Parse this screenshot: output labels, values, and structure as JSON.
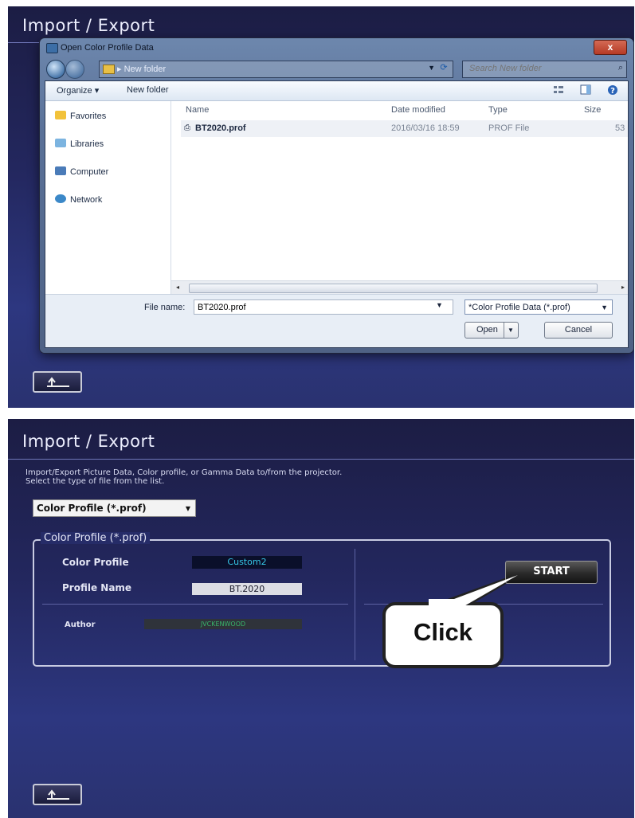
{
  "top": {
    "panel_title": "Import / Export",
    "dialog": {
      "title": "Open Color Profile Data",
      "close_label": "x",
      "breadcrumb": "▸ New folder",
      "search_placeholder": "Search New folder",
      "toolbar": {
        "organize": "Organize ▾",
        "new_folder": "New folder"
      },
      "nav": [
        {
          "label": "Favorites",
          "icon": "star-icon"
        },
        {
          "label": "Libraries",
          "icon": "libraries-icon"
        },
        {
          "label": "Computer",
          "icon": "computer-icon"
        },
        {
          "label": "Network",
          "icon": "network-icon"
        }
      ],
      "columns": {
        "name": "Name",
        "date": "Date modified",
        "type": "Type",
        "size": "Size"
      },
      "files": [
        {
          "name": "BT2020.prof",
          "date": "2016/03/16 18:59",
          "type": "PROF File",
          "size": "53"
        }
      ],
      "file_name_label": "File name:",
      "file_name_value": "BT2020.prof",
      "file_type": "*Color Profile Data (*.prof)",
      "open_label": "Open",
      "cancel_label": "Cancel"
    }
  },
  "bottom": {
    "panel_title": "Import / Export",
    "description_line1": "Import/Export Picture Data, Color profile, or Gamma Data to/from the projector.",
    "description_line2": "Select the type of file from the list.",
    "type_select": "Color Profile (*.prof)",
    "group_label": "Color Profile (*.prof)",
    "fields": {
      "color_profile_label": "Color Profile",
      "color_profile_value": "Custom2",
      "profile_name_label": "Profile Name",
      "profile_name_value": "BT.2020",
      "author_label": "Author",
      "author_value": "JVCKENWOOD"
    },
    "start_label": "START",
    "callout_text": "Click"
  },
  "colors": {
    "panel_bg": "#23275e",
    "value_cyan": "#36c7e6",
    "author_green": "#38b46a"
  }
}
